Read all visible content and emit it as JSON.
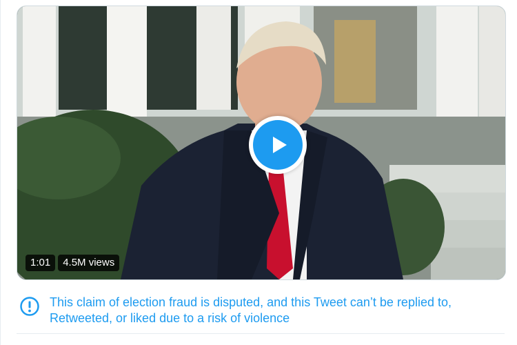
{
  "media": {
    "duration": "1:01",
    "views": "4.5M views",
    "play_icon": "play-icon"
  },
  "notice": {
    "icon": "exclamation-circle-icon",
    "text": "This claim of election fraud is disputed, and this Tweet can’t be replied to, Retweeted, or liked due to a risk of violence"
  },
  "colors": {
    "accent": "#1d9bf0",
    "badge_bg": "#000000"
  }
}
